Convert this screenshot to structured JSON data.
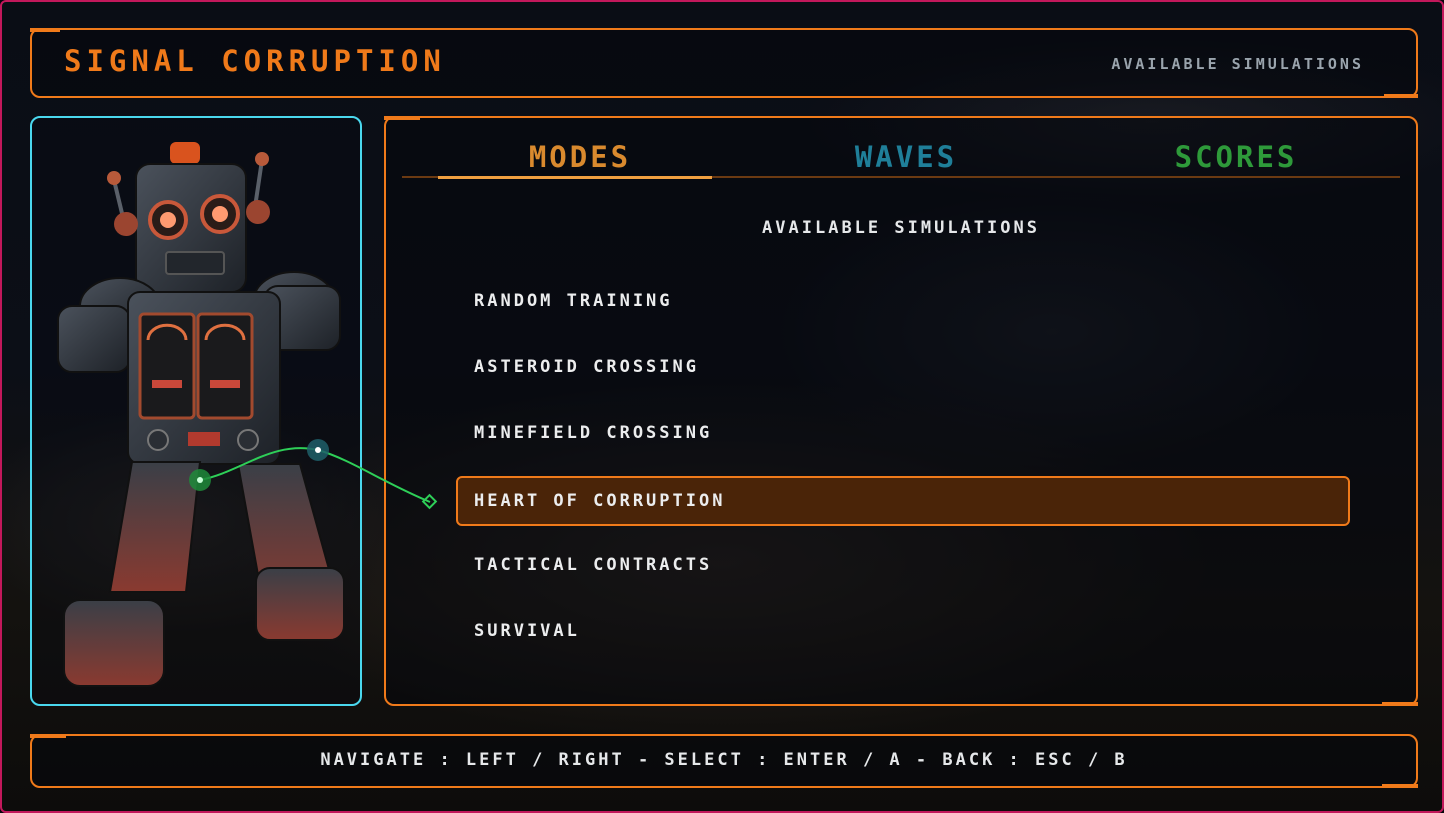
{
  "header": {
    "title": "SIGNAL CORRUPTION",
    "subtitle": "AVAILABLE SIMULATIONS"
  },
  "tabs": [
    {
      "label": "MODES",
      "active": true,
      "color": "#d98a2e"
    },
    {
      "label": "WAVES",
      "active": false,
      "color": "#1f7f99"
    },
    {
      "label": "SCORES",
      "active": false,
      "color": "#2e9a3a"
    }
  ],
  "panel": {
    "subtitle": "AVAILABLE SIMULATIONS",
    "items": [
      {
        "label": "RANDOM TRAINING",
        "selected": false
      },
      {
        "label": "ASTEROID CROSSING",
        "selected": false
      },
      {
        "label": "MINEFIELD CROSSING",
        "selected": false
      },
      {
        "label": "HEART OF CORRUPTION",
        "selected": true
      },
      {
        "label": "TACTICAL CONTRACTS",
        "selected": false
      },
      {
        "label": "SURVIVAL",
        "selected": false
      }
    ]
  },
  "footer": {
    "hint": "NAVIGATE : LEFT / RIGHT - SELECT : ENTER / A - BACK : ESC / B"
  },
  "colors": {
    "accent": "#f07a1a",
    "portrait_border": "#4ad8ee",
    "window_border": "#c2185b",
    "selected_bg": "#4a2408"
  },
  "icons": [
    "robot-portrait",
    "connector-line"
  ]
}
